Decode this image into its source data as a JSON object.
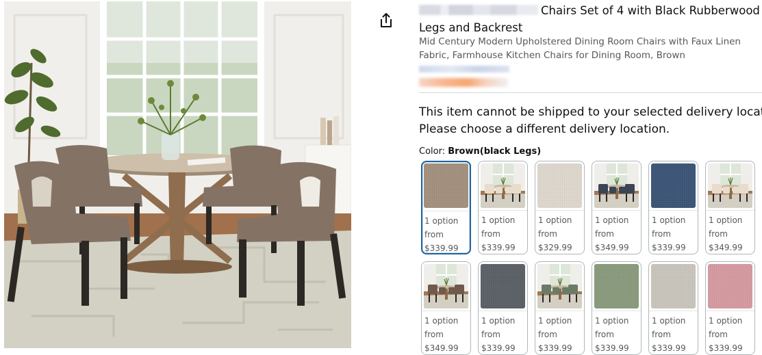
{
  "product": {
    "title": "Chairs Set of 4 with Black Rubberwood Legs and Backrest",
    "subtitle": "Mid Century Modern Upholstered Dining Room Chairs with Faux Linen Fabric, Farmhouse Kitchen Chairs for Dining Room, Brown"
  },
  "share": {
    "icon": "share-icon"
  },
  "notice": {
    "line1": "This item cannot be shipped to your selected delivery location.",
    "line2": "Please choose a different delivery location."
  },
  "color": {
    "label": "Color:",
    "selected": "Brown(black Legs)"
  },
  "swatches": [
    {
      "kind": "fabric",
      "color": "#a3907f",
      "options": "1 option",
      "from": "from",
      "price": "$339.99",
      "selected": true
    },
    {
      "kind": "room",
      "chair": "#e8dccb",
      "options": "1 option",
      "from": "from",
      "price": "$339.99"
    },
    {
      "kind": "fabric",
      "color": "#dcd6cd",
      "options": "1 option",
      "from": "from",
      "price": "$329.99"
    },
    {
      "kind": "room",
      "chair": "#3a4556",
      "options": "1 option",
      "from": "from",
      "price": "$349.99"
    },
    {
      "kind": "fabric",
      "color": "#3d5677",
      "options": "1 option",
      "from": "from",
      "price": "$339.99"
    },
    {
      "kind": "room",
      "chair": "#e8dccb",
      "options": "1 option",
      "from": "from",
      "price": "$349.99"
    },
    {
      "kind": "room",
      "chair": "#6f5a4b",
      "options": "1 option",
      "from": "from",
      "price": "$349.99"
    },
    {
      "kind": "fabric",
      "color": "#5c6168",
      "options": "1 option",
      "from": "from",
      "price": "$339.99"
    },
    {
      "kind": "room",
      "chair": "#6b7b66",
      "options": "1 option",
      "from": "from",
      "price": "$339.99"
    },
    {
      "kind": "fabric",
      "color": "#8a9a7d",
      "options": "1 option",
      "from": "from",
      "price": "$339.99"
    },
    {
      "kind": "fabric",
      "color": "#c9c4bb",
      "options": "1 option",
      "from": "from",
      "price": "$339.99"
    },
    {
      "kind": "fabric",
      "color": "#d49aa0",
      "options": "1 option",
      "from": "from",
      "price": "$339.99"
    }
  ]
}
